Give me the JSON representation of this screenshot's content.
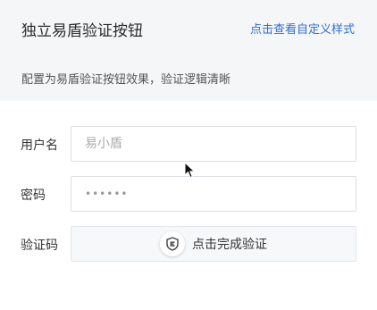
{
  "header": {
    "title": "独立易盾验证按钮",
    "custom_link": "点击查看自定义样式",
    "description": "配置为易盾验证按钮效果，验证逻辑清晰"
  },
  "form": {
    "username": {
      "label": "用户名",
      "placeholder": "易小盾",
      "value": ""
    },
    "password": {
      "label": "密码",
      "value": "••••••"
    },
    "captcha": {
      "label": "验证码",
      "button_text": "点击完成验证",
      "icon": "shield-icon"
    }
  },
  "colors": {
    "accent": "#2f6fd6",
    "header_bg": "#f4f6f8",
    "captcha_bg": "#f6f8fa"
  }
}
